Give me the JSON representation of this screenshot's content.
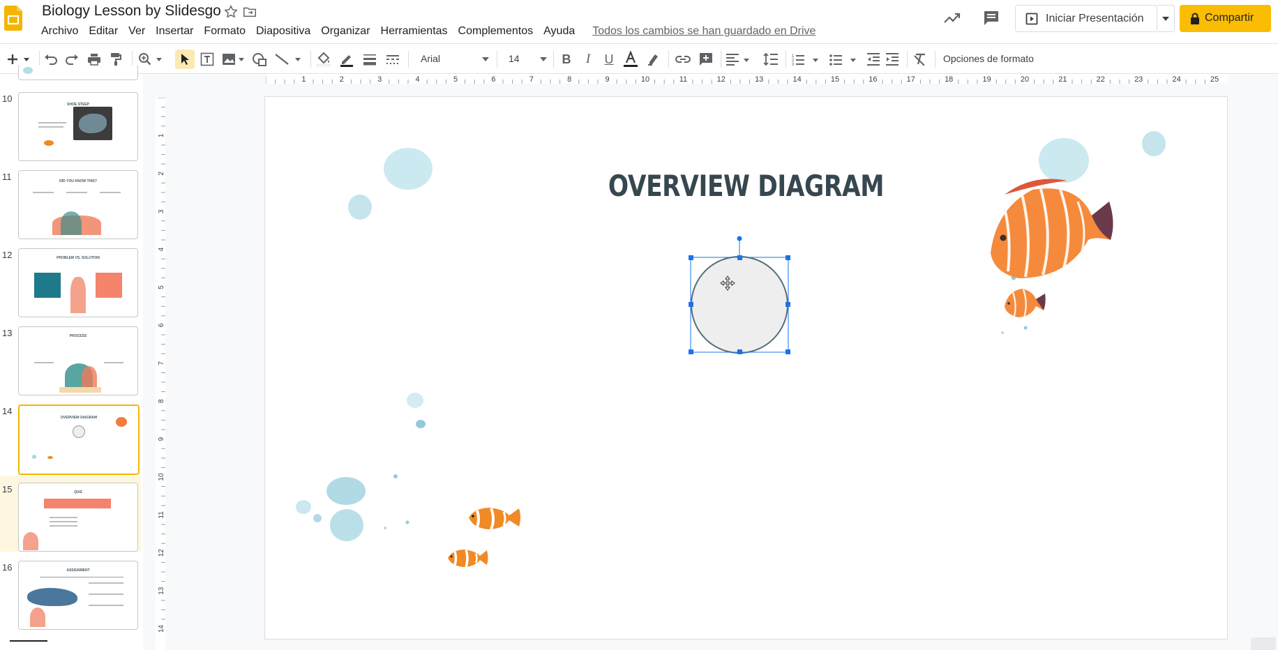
{
  "app": {
    "title": "Biology Lesson by Slidesgo",
    "saved_status": "Todos los cambios se han guardado en Drive"
  },
  "menu": [
    "Archivo",
    "Editar",
    "Ver",
    "Insertar",
    "Formato",
    "Diapositiva",
    "Organizar",
    "Herramientas",
    "Complementos",
    "Ayuda"
  ],
  "buttons": {
    "present": "Iniciar Presentación",
    "share": "Compartir"
  },
  "toolbar": {
    "font": "Arial",
    "font_size": "14",
    "format_options": "Opciones de formato"
  },
  "ruler": {
    "h_ticks": [
      "1",
      "2",
      "3",
      "4",
      "5",
      "6",
      "7",
      "8",
      "9",
      "10",
      "11",
      "12",
      "13",
      "14",
      "15",
      "16",
      "17",
      "18",
      "19",
      "20",
      "21",
      "22",
      "23",
      "24",
      "25"
    ],
    "v_ticks": [
      "1",
      "2",
      "3",
      "4",
      "5",
      "6",
      "7",
      "8",
      "9",
      "10",
      "11",
      "12",
      "13",
      "14"
    ]
  },
  "filmstrip": {
    "slides": [
      {
        "num": "10",
        "title": "SHOE STEEP"
      },
      {
        "num": "11",
        "title": "DID YOU KNOW THIS?"
      },
      {
        "num": "12",
        "title": "PROBLEM VS. SOLUTION"
      },
      {
        "num": "13",
        "title": "PROCESS"
      },
      {
        "num": "14",
        "title": "OVERVIEW DIAGRAM"
      },
      {
        "num": "15",
        "title": "QUIZ"
      },
      {
        "num": "16",
        "title": "ASSIGNMENT"
      }
    ],
    "selected": "14"
  },
  "slide": {
    "title": "OVERVIEW DIAGRAM"
  },
  "colors": {
    "accent": "#fbbc04",
    "selection": "#1a73e8",
    "title": "#37474f",
    "shape_fill": "#eeeeee"
  },
  "icons": [
    "slides-logo-icon",
    "star-icon",
    "move-to-folder-icon",
    "activity-trend-icon",
    "comments-icon",
    "present-icon",
    "lock-icon",
    "add-icon",
    "undo-icon",
    "redo-icon",
    "print-icon",
    "paint-format-icon",
    "zoom-icon",
    "select-icon",
    "textbox-icon",
    "image-icon",
    "shape-icon",
    "line-icon",
    "fill-color-icon",
    "border-color-icon",
    "border-weight-icon",
    "border-dash-icon",
    "bold-icon",
    "italic-icon",
    "underline-icon",
    "text-color-icon",
    "highlight-icon",
    "link-icon",
    "comment-add-icon",
    "align-icon",
    "line-spacing-icon",
    "numbered-list-icon",
    "bulleted-list-icon",
    "indent-decrease-icon",
    "indent-increase-icon",
    "clear-formatting-icon",
    "move-cursor-icon"
  ]
}
